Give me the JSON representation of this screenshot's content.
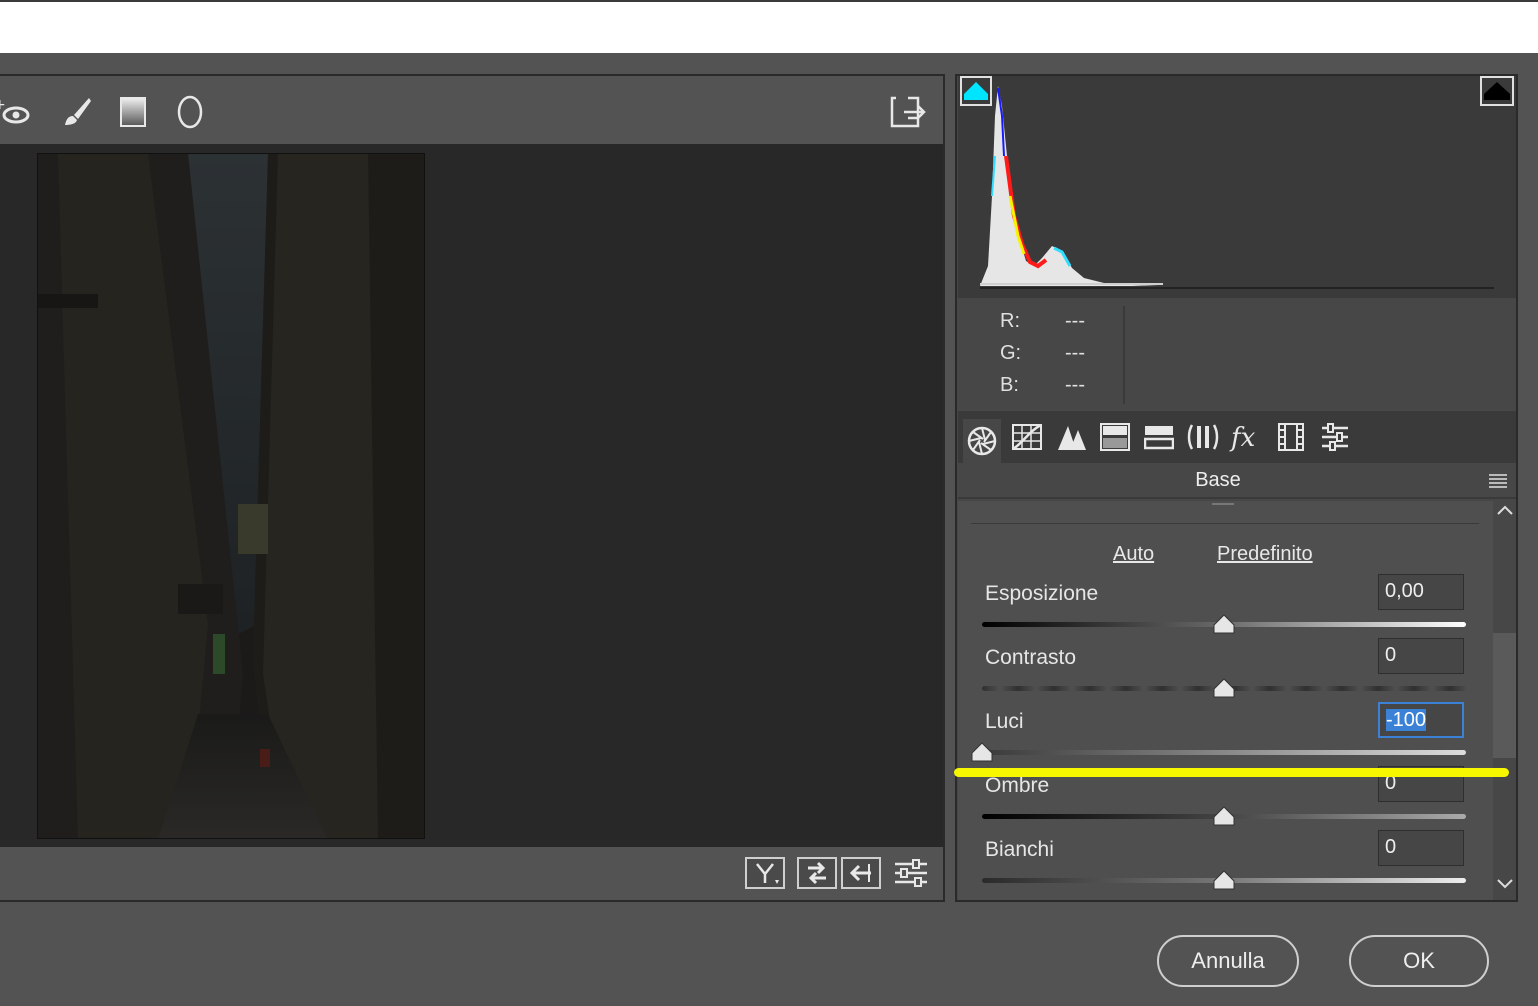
{
  "toolbar": {
    "tools": [
      {
        "icon": "red-eye-icon"
      },
      {
        "icon": "brush-icon"
      },
      {
        "icon": "graduated-filter-icon"
      },
      {
        "icon": "radial-filter-icon"
      }
    ],
    "export_icon": "open-preferences-icon"
  },
  "histogram": {
    "shadow_clip_color": "#00e5ff",
    "highlight_clip_color": "#000000"
  },
  "rgb": {
    "r_label": "R:",
    "r_value": "---",
    "g_label": "G:",
    "g_value": "---",
    "b_label": "B:",
    "b_value": "---"
  },
  "tabs": [
    "basic-tab-icon",
    "tone-curve-tab-icon",
    "detail-tab-icon",
    "hsl-tab-icon",
    "split-toning-tab-icon",
    "lens-corrections-tab-icon",
    "effects-tab-icon",
    "camera-calibration-tab-icon",
    "presets-tab-icon"
  ],
  "panel": {
    "section_title": "Base",
    "auto_label": "Auto",
    "default_label": "Predefinito",
    "sliders": [
      {
        "label": "Esposizione",
        "value": "0,00",
        "position": 0.5
      },
      {
        "label": "Contrasto",
        "value": "0",
        "position": 0.5
      },
      {
        "label": "Luci",
        "value": "-100",
        "position": 0.0
      },
      {
        "label": "Ombre",
        "value": "0",
        "position": 0.5
      },
      {
        "label": "Bianchi",
        "value": "0",
        "position": 0.5
      }
    ]
  },
  "buttons": {
    "cancel": "Annulla",
    "ok": "OK"
  },
  "colors": {
    "annotation_highlight": "#f7f700",
    "selection": "#3b82d6"
  }
}
